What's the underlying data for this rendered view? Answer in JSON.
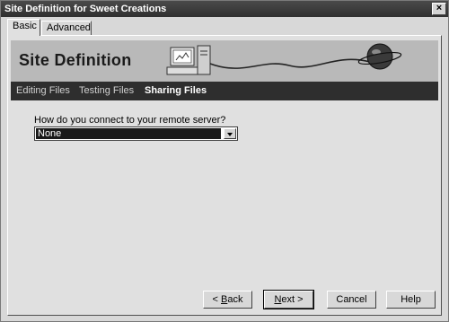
{
  "window": {
    "title": "Site Definition for Sweet Creations",
    "close_glyph": "×"
  },
  "tabs": [
    {
      "label": "Basic",
      "active": true
    },
    {
      "label": "Advanced",
      "active": false
    }
  ],
  "banner": {
    "title": "Site Definition"
  },
  "steps": [
    {
      "label": "Editing Files",
      "current": false
    },
    {
      "label": "Testing Files",
      "current": false
    },
    {
      "label": "Sharing Files",
      "current": true
    }
  ],
  "connection": {
    "question": "How do you connect to your remote server?",
    "selected": "None"
  },
  "buttons": {
    "back_mnemonic": "B",
    "back_rest": "ack",
    "back_prefix": "< ",
    "next_mnemonic": "N",
    "next_rest": "ext >",
    "cancel": "Cancel",
    "help": "Help"
  },
  "icons": {
    "banner_computer": "computer-icon",
    "banner_globe": "globe-icon"
  }
}
